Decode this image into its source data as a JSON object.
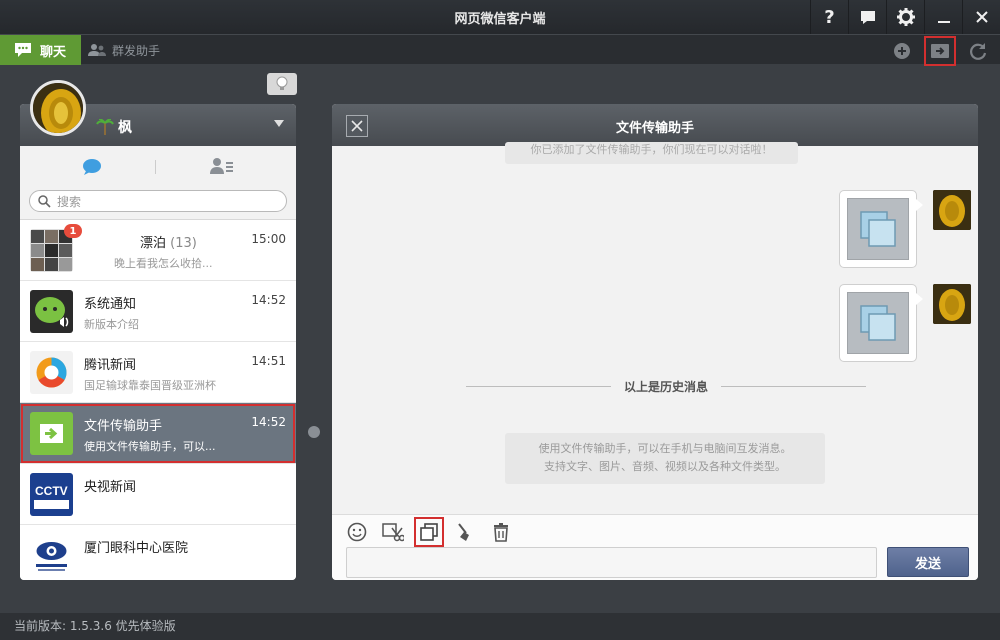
{
  "window": {
    "title": "网页微信客户端"
  },
  "toolbar": {
    "chat_label": "聊天",
    "mass_label": "群发助手"
  },
  "profile": {
    "name": "枫"
  },
  "search": {
    "placeholder": "搜索"
  },
  "conversations": [
    {
      "name": "漂泊",
      "count": "(13)",
      "preview": "晚上看我怎么收拾...",
      "time": "15:00",
      "badge": "1"
    },
    {
      "name": "系统通知",
      "preview": "新版本介绍",
      "time": "14:52"
    },
    {
      "name": "腾讯新闻",
      "preview": "国足输球靠泰国晋级亚洲杯",
      "time": "14:51"
    },
    {
      "name": "文件传输助手",
      "preview": "使用文件传输助手，可以...",
      "time": "14:52"
    },
    {
      "name": "央视新闻",
      "preview": "",
      "time": ""
    },
    {
      "name": "厦门眼科中心医院",
      "preview": "",
      "time": ""
    }
  ],
  "chat": {
    "title": "文件传输助手",
    "system_top": "你已添加了文件传输助手，你们现在可以对话啦！",
    "history_label": "以上是历史消息",
    "system_bottom_line1": "使用文件传输助手，可以在手机与电脑间互发消息。",
    "system_bottom_line2": "支持文字、图片、音频、视频以及各种文件类型。",
    "send_label": "发送"
  },
  "status": {
    "version_text": "当前版本: 1.5.3.6 优先体验版"
  },
  "colors": {
    "accent_green": "#5f9a34",
    "highlight_red": "#d32f2f",
    "send_blue": "#5a6d96"
  }
}
